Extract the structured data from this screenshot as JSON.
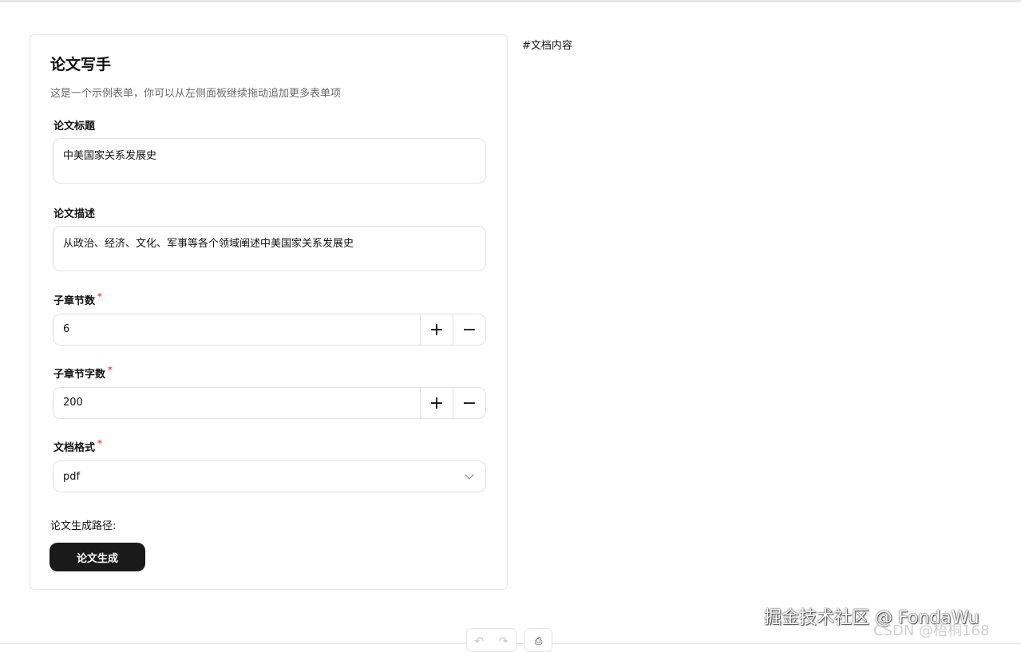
{
  "form": {
    "title": "论文写手",
    "description": "这是一个示例表单，你可以从左侧面板继续拖动追加更多表单项",
    "fields": {
      "paper_title": {
        "label": "论文标题",
        "value": "中美国家关系发展史"
      },
      "paper_description": {
        "label": "论文描述",
        "value": "从政治、经济、文化、军事等各个领域阐述中美国家关系发展史"
      },
      "section_count": {
        "label": "子章节数",
        "required_mark": "*",
        "value": "6",
        "increment_symbol": "+",
        "decrement_symbol": "−"
      },
      "section_word_count": {
        "label": "子章节字数",
        "required_mark": "*",
        "value": "200",
        "increment_symbol": "+",
        "decrement_symbol": "−"
      },
      "document_format": {
        "label": "文档格式",
        "required_mark": "*",
        "value": "pdf"
      }
    },
    "output_path_label": "论文生成路径:",
    "generate_button_label": "论文生成"
  },
  "document_panel": {
    "content": "#文档内容"
  },
  "bottom_toolbar": {
    "undo_symbol": "↶",
    "redo_symbol": "↷",
    "export_symbol": "⎙"
  },
  "watermark": {
    "main": "掘金技术社区 @ FondaWu",
    "sub": "CSDN @梧桐168"
  },
  "colors": {
    "primary_button": "#1a1a1a",
    "required": "#ef4444",
    "border": "#e2e2e2",
    "muted_text": "#6b6b6b"
  },
  "icons": [
    "plus-icon",
    "minus-icon",
    "chevron-down-icon",
    "undo-icon",
    "redo-icon",
    "export-icon"
  ]
}
